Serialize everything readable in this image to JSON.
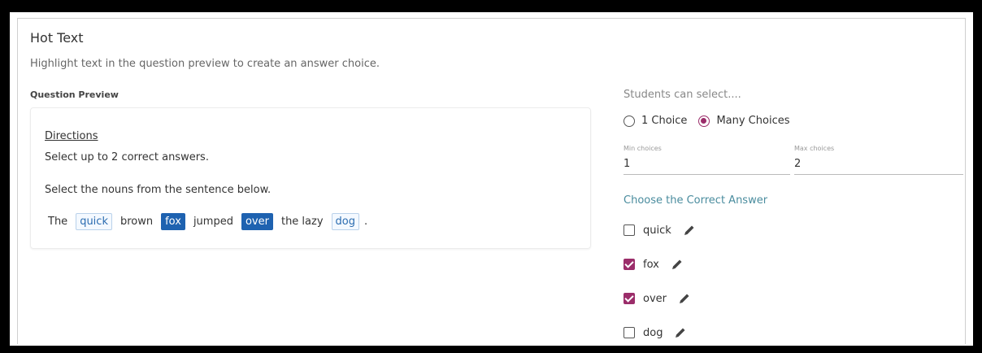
{
  "header": {
    "title": "Hot Text",
    "subtitle": "Highlight text in the question preview to create an answer choice."
  },
  "preview": {
    "label": "Question Preview",
    "directions_heading": "Directions",
    "directions_text": "Select up to 2 correct answers.",
    "question_text": "Select the nouns from the sentence below.",
    "tokens": [
      {
        "text": "The",
        "style": "plain"
      },
      {
        "text": "quick",
        "style": "outline"
      },
      {
        "text": "brown",
        "style": "plain"
      },
      {
        "text": "fox",
        "style": "filled"
      },
      {
        "text": "jumped",
        "style": "plain"
      },
      {
        "text": "over",
        "style": "filled"
      },
      {
        "text": "the lazy",
        "style": "plain"
      },
      {
        "text": "dog",
        "style": "outline"
      },
      {
        "text": ".",
        "style": "plain"
      }
    ]
  },
  "selection": {
    "label": "Students can select....",
    "option_one": "1 Choice",
    "option_many": "Many Choices",
    "selected": "many",
    "min_label": "Min choices",
    "min_value": "1",
    "max_label": "Max choices",
    "max_value": "2"
  },
  "answers": {
    "heading": "Choose the Correct Answer",
    "choices": [
      {
        "label": "quick",
        "checked": false
      },
      {
        "label": "fox",
        "checked": true
      },
      {
        "label": "over",
        "checked": true
      },
      {
        "label": "dog",
        "checked": false
      }
    ]
  },
  "colors": {
    "accent": "#9b2d6a",
    "highlight": "#1e62b0",
    "link": "#4a8c9e"
  }
}
